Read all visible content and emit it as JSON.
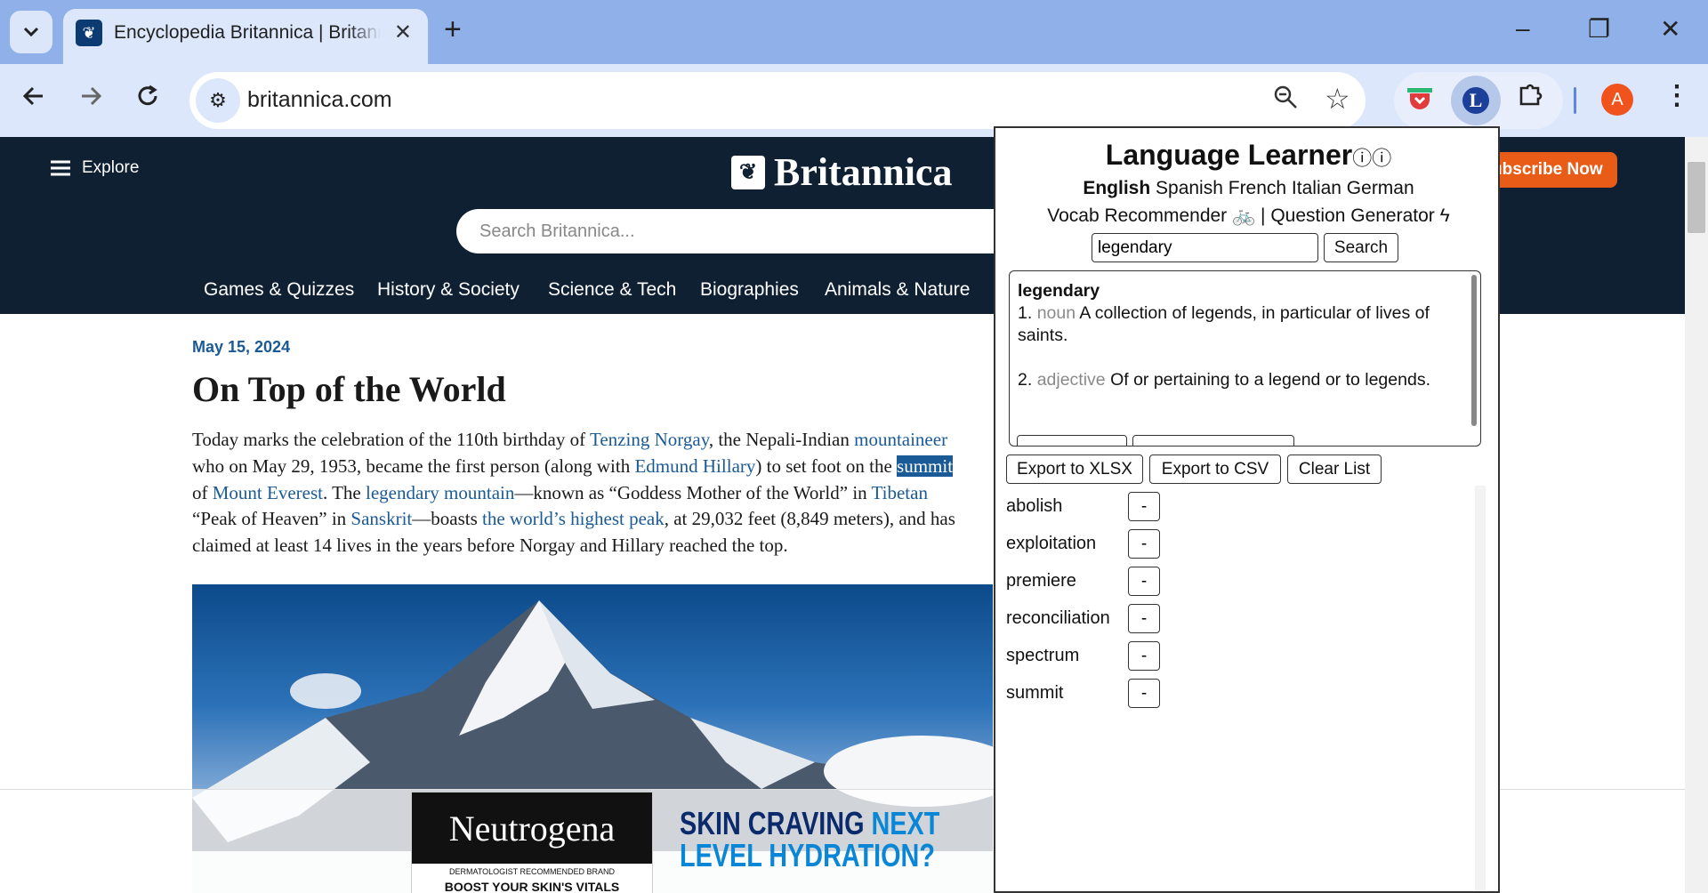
{
  "browser": {
    "tab_title": "Encyclopedia Britannica | Britannica",
    "url": "britannica.com",
    "profile_initial": "A"
  },
  "site": {
    "explore": "Explore",
    "brand": "Britannica",
    "search_placeholder": "Search Britannica...",
    "subscribe": "Subscribe Now",
    "nav": [
      "Games & Quizzes",
      "History & Society",
      "Science & Tech",
      "Biographies",
      "Animals & Nature"
    ]
  },
  "article": {
    "date": "May 15, 2024",
    "headline": "On Top of the World",
    "line1": {
      "a": "Today marks the celebration of the 110th birthday of ",
      "link1": "Tenzing Norgay",
      "b": ", the Nepali-Indian ",
      "link2": "mountaineer"
    },
    "line2": {
      "a": "who on May 29, 1953, became the first person (along with ",
      "link1": "Edmund Hillary",
      "b": ") to set foot on the ",
      "hl": "summit"
    },
    "line3": {
      "a": "of ",
      "link1": "Mount Everest",
      "b": ". The ",
      "link2": "legendary mountain",
      "c": "—known as “Goddess Mother of the World” in ",
      "link3": "Tibetan"
    },
    "line4": {
      "a": "“Peak of Heaven” in ",
      "link1": "Sanskrit",
      "b": "—boasts ",
      "link2": "the world’s highest peak",
      "c": ", at 29,032 feet (8,849 meters), and has"
    },
    "line5": "claimed at least 14 lives in the years before Norgay and Hillary reached the top."
  },
  "ad": {
    "brand": "Neutrogena",
    "sub1": "DERMATOLOGIST RECOMMENDED BRAND",
    "sub2": "BOOST YOUR SKIN'S VITALS",
    "copy1": "SKIN CRAVING",
    "copy1b": "NEXT",
    "copy2": "LEVEL HYDRATION?"
  },
  "popup": {
    "title": "Language Learner",
    "languages": {
      "selected": "English",
      "others": "Spanish French Italian German"
    },
    "tools": {
      "vocab": "Vocab Recommender",
      "sep": "|",
      "questions": "Question Generator"
    },
    "search_value": "legendary",
    "search_button": "Search",
    "definition": {
      "word": "legendary",
      "entries": [
        {
          "num": "1.",
          "pos": "noun",
          "text": "A collection of legends, in particular of lives of saints."
        },
        {
          "num": "2.",
          "pos": "adjective",
          "text": "Of or pertaining to a legend or to legends."
        }
      ]
    },
    "export_xlsx": "Export to XLSX",
    "export_csv": "Export to CSV",
    "clear_list": "Clear List",
    "remove_label": "-",
    "words": [
      "abolish",
      "exploitation",
      "premiere",
      "reconciliation",
      "spectrum",
      "summit"
    ]
  }
}
